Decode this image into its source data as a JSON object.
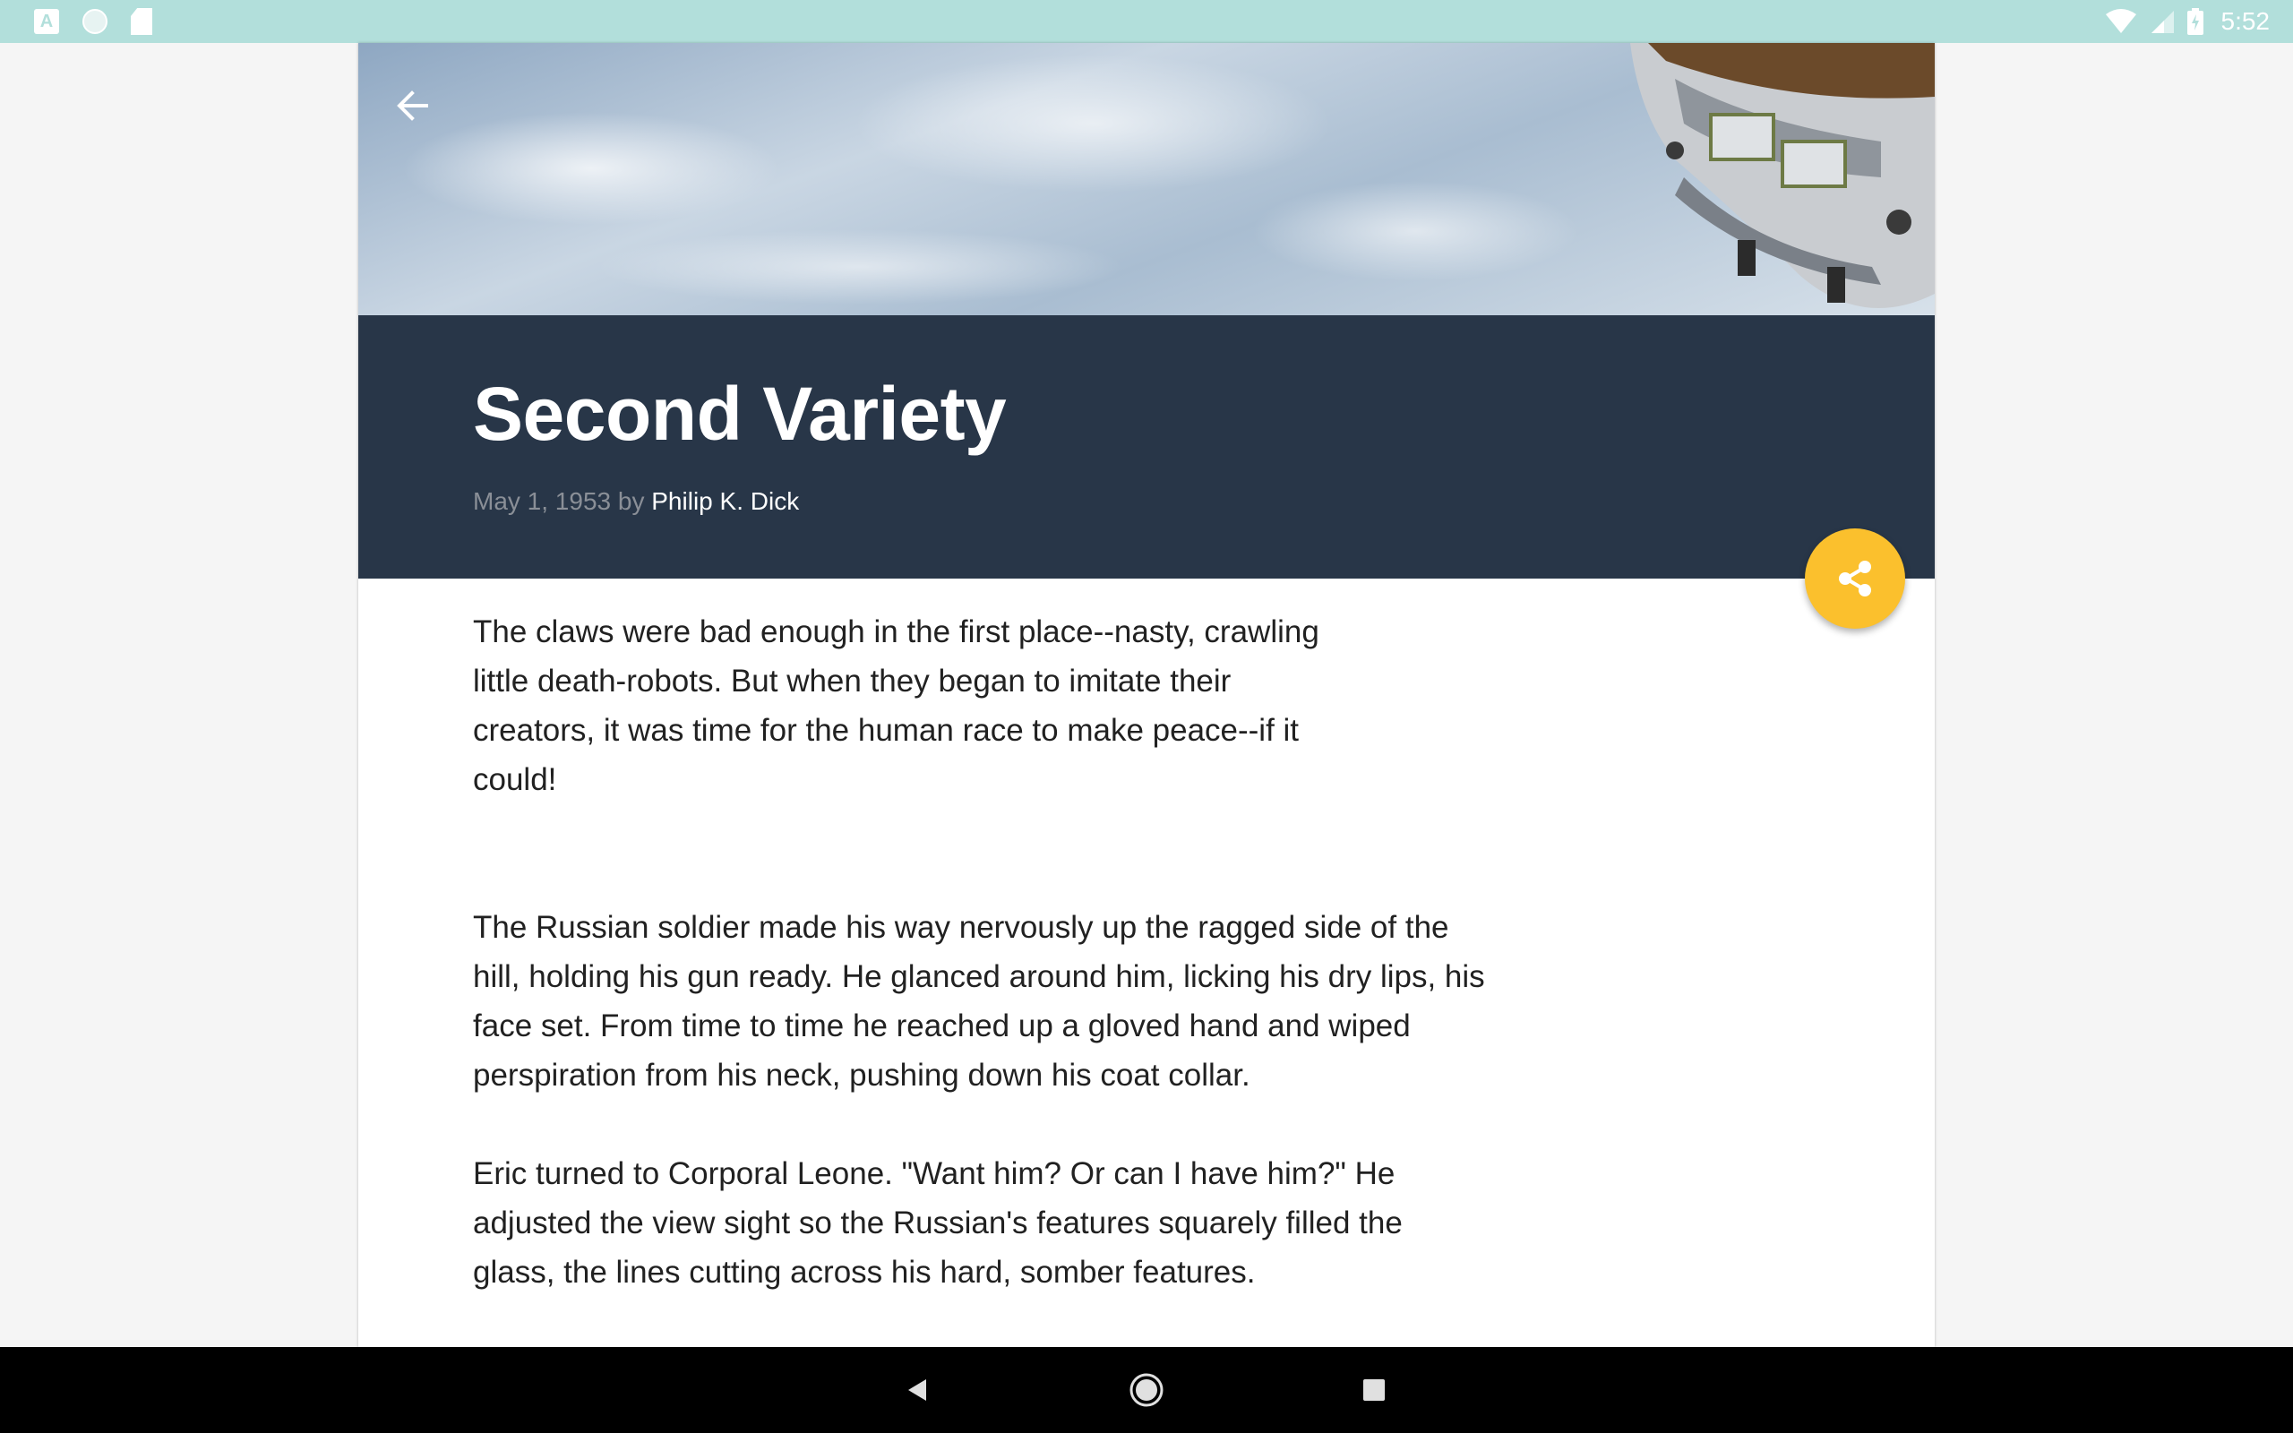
{
  "status_bar": {
    "time": "5:52",
    "left_icons": [
      "a-notification-icon",
      "circle-notification-icon",
      "sd-card-icon"
    ],
    "right_icons": [
      "wifi-icon",
      "cell-signal-icon",
      "battery-icon"
    ]
  },
  "article": {
    "title": "Second Variety",
    "date": "May 1, 1953",
    "by": "by",
    "author": "Philip K. Dick",
    "teaser": "The claws were bad enough in the first place--nasty, crawling little death-robots. But when they began to imitate their creators, it was time for the human race to make peace--if it could!",
    "paragraphs": [
      "The Russian soldier made his way nervously up the ragged side of the hill, holding his gun ready. He glanced around him, licking his dry lips, his face set. From time to time he reached up a gloved hand and wiped perspiration from his neck, pushing down his coat collar.",
      "Eric turned to Corporal Leone. \"Want him? Or can I have him?\" He adjusted the view sight so the Russian's features squarely filled the glass, the lines cutting across his hard, somber features."
    ]
  },
  "buttons": {
    "back_icon": "arrow-back-icon",
    "share_icon": "share-icon"
  },
  "nav_bar": {
    "icons": [
      "nav-back-icon",
      "nav-home-icon",
      "nav-recents-icon"
    ]
  },
  "colors": {
    "status_bar": "#b2dfdb",
    "title_band": "#283648",
    "fab": "#fbc02d",
    "byline_date": "#8a8f97",
    "body_text": "#212121"
  }
}
